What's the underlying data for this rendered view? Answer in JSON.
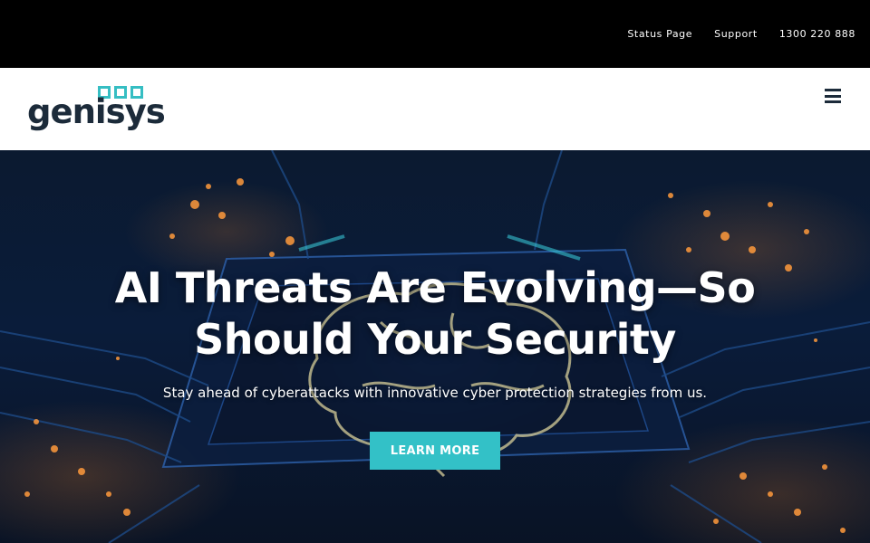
{
  "topbar": {
    "links": [
      {
        "label": "Status Page"
      },
      {
        "label": "Support"
      },
      {
        "label": "1300 220 888"
      }
    ]
  },
  "header": {
    "logo_text": "genisys",
    "menu_icon": "hamburger-menu-icon"
  },
  "hero": {
    "title": "AI Threats Are Evolving—So Should Your Security",
    "subtitle": "Stay ahead of cyberattacks with innovative cyber protection strategies from us.",
    "button_label": "LEARN MORE"
  },
  "colors": {
    "topbar_bg": "#000000",
    "header_bg": "#ffffff",
    "brand_navy": "#1c2b3a",
    "brand_teal": "#33c1c7"
  }
}
